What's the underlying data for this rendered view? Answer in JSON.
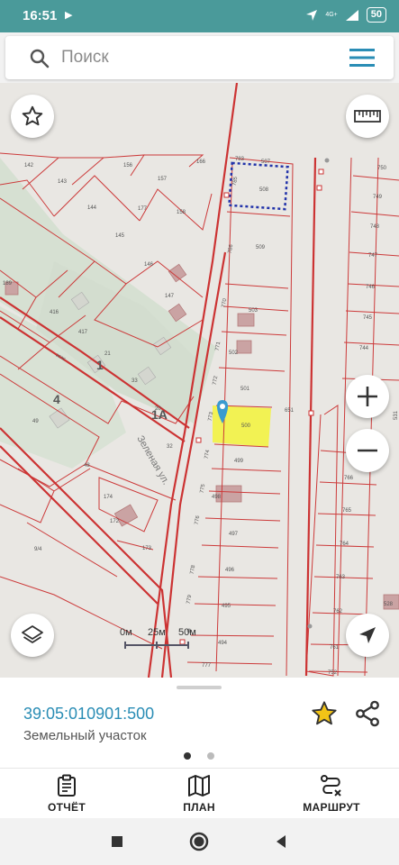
{
  "status_bar": {
    "time": "16:51",
    "network": "4G+",
    "battery": "50"
  },
  "search": {
    "placeholder": "Поиск"
  },
  "map": {
    "labels": {
      "l142": "142",
      "l156": "156",
      "l166": "166",
      "l143": "143",
      "l157": "157",
      "l144": "144",
      "l177": "177",
      "l158": "158",
      "l145": "145",
      "l146": "146",
      "l147": "147",
      "l189": "189",
      "l416": "416",
      "l417": "417",
      "l21": "21",
      "l1": "1",
      "l33": "33",
      "l4": "4",
      "l49": "49",
      "l1a": "1А",
      "l20": "20",
      "l32": "32",
      "l48": "48",
      "l174": "174",
      "l172": "172",
      "l173": "173",
      "l94": "9/4",
      "l783": "783",
      "l507": "507",
      "l785": "785",
      "l508": "508",
      "l509": "509",
      "l786": "786",
      "l770": "770",
      "l503": "503",
      "l771": "771",
      "l502": "502",
      "l772": "772",
      "l501": "501",
      "l773": "773",
      "l651": "651",
      "l500": "500",
      "l774": "774",
      "l499": "499",
      "l775": "775",
      "l498": "498",
      "l776": "776",
      "l497": "497",
      "l778": "778",
      "l496": "496",
      "l779": "779",
      "l495": "495",
      "l494": "494",
      "l777": "777",
      "l750": "750",
      "l749": "749",
      "l748": "748",
      "l747": "747",
      "l746": "746",
      "l745": "745",
      "l744": "744",
      "l743": "743",
      "l531": "531",
      "l766": "766",
      "l765": "765",
      "l764": "764",
      "l763": "763",
      "l762": "762",
      "l761": "761",
      "l752": "752",
      "l528": "528",
      "street": "Зеленая ул.",
      "street_code": "ЗЕЛЕ"
    },
    "scale": {
      "zero": "0м",
      "mid": "25м",
      "end": "50м"
    },
    "highlight_color": "#f3f33a",
    "icons": {
      "favorite": "star-outline-icon",
      "ruler": "ruler-icon",
      "zoom_in": "plus-icon",
      "zoom_out": "minus-icon",
      "layers": "layers-icon",
      "locate": "navigation-arrow-icon"
    }
  },
  "panel": {
    "cadastral_number": "39:05:010901:500",
    "object_type": "Земельный участок",
    "star_color": "#f2c417",
    "active_dot_color": "#333333",
    "inactive_dot_color": "#bbbbbb"
  },
  "nav": {
    "report": "ОТЧЁТ",
    "plan": "ПЛАН",
    "route": "МАРШРУТ"
  },
  "colors": {
    "accent": "#2a8db5",
    "status_bar": "#4a9a9a",
    "parcel_line": "#cc3a3a"
  }
}
